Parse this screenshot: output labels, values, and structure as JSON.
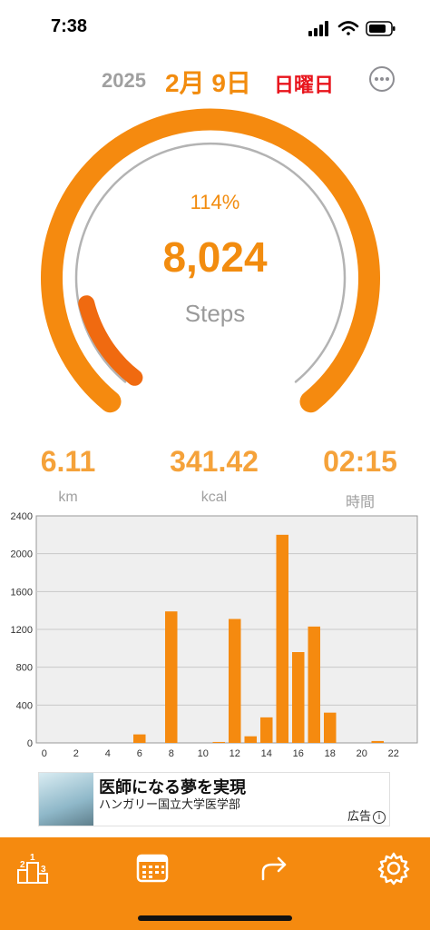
{
  "status_bar": {
    "time": "7:38"
  },
  "header": {
    "year": "2025",
    "month_day": "2月 9日",
    "weekday": "日曜日",
    "more_icon": "ellipsis-circle-icon"
  },
  "gauge": {
    "percent_text": "114%",
    "progress_fraction": 1.14,
    "steps": "8,024",
    "steps_label": "Steps"
  },
  "stats": [
    {
      "value": "6.11",
      "unit": "km"
    },
    {
      "value": "341.42",
      "unit": "kcal"
    },
    {
      "value": "02:15",
      "unit": "時間"
    }
  ],
  "chart_data": {
    "type": "bar",
    "x": [
      0,
      1,
      2,
      3,
      4,
      5,
      6,
      7,
      8,
      9,
      10,
      11,
      12,
      13,
      14,
      15,
      16,
      17,
      18,
      19,
      20,
      21,
      22,
      23
    ],
    "values": [
      0,
      0,
      0,
      0,
      0,
      0,
      90,
      0,
      1390,
      0,
      0,
      10,
      1310,
      70,
      270,
      2200,
      960,
      1230,
      320,
      0,
      0,
      20,
      0,
      0
    ],
    "x_ticks": [
      "0",
      "2",
      "4",
      "6",
      "8",
      "10",
      "12",
      "14",
      "16",
      "18",
      "20",
      "22"
    ],
    "y_ticks": [
      "0",
      "400",
      "800",
      "1200",
      "1600",
      "2000",
      "2400"
    ],
    "ylim": [
      0,
      2400
    ],
    "color": "#f58a0f",
    "grid": true
  },
  "ad": {
    "title": "医師になる夢を実現",
    "subtitle": "ハンガリー国立大学医学部",
    "badge": "広告"
  },
  "tabbar": {
    "items": [
      {
        "icon": "ranking-podium-icon"
      },
      {
        "icon": "calendar-icon"
      },
      {
        "icon": "share-arrow-icon"
      },
      {
        "icon": "gear-icon"
      }
    ]
  },
  "colors": {
    "accent": "#f58a0f",
    "dark_accent": "#f06a10",
    "weekday": "#e8141c",
    "muted": "#a0a0a0"
  }
}
